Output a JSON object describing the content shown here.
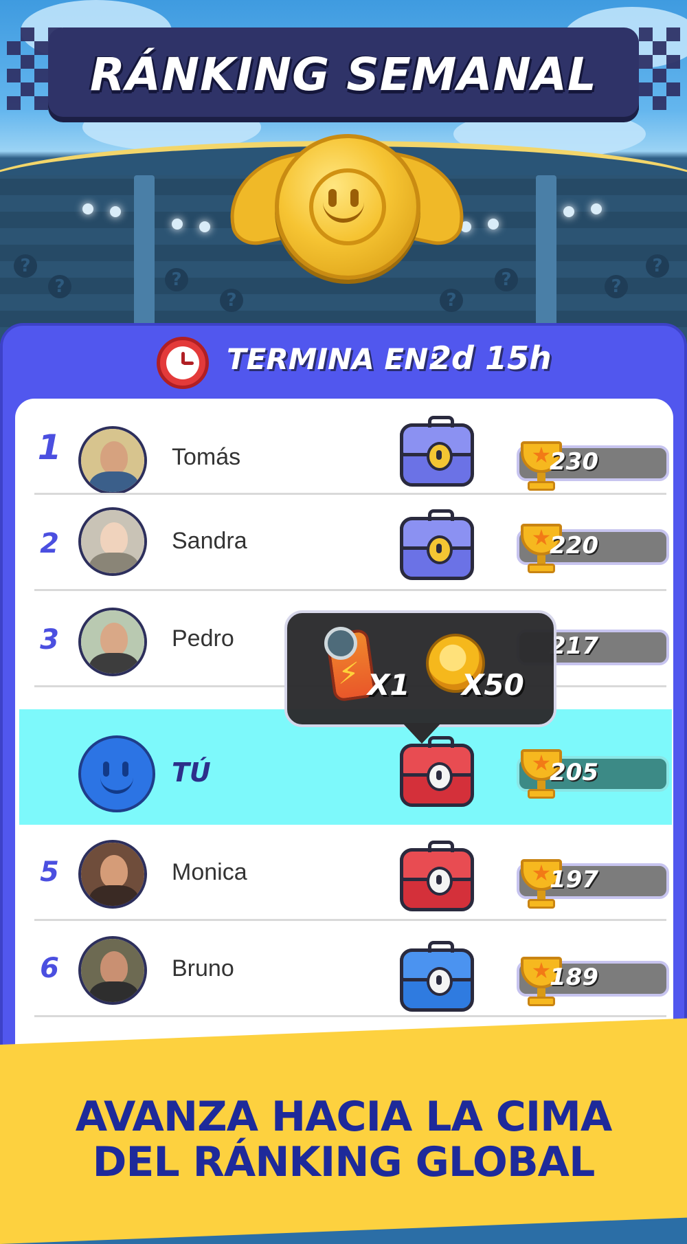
{
  "header": {
    "title": "RÁNKING SEMANAL"
  },
  "timer": {
    "label": "TERMINA EN:",
    "value": "2d 15h",
    "icon": "clock-icon"
  },
  "leaderboard": [
    {
      "rank": "1",
      "name": "Tomás",
      "score": "230",
      "chest": "purple-chest"
    },
    {
      "rank": "2",
      "name": "Sandra",
      "score": "220",
      "chest": "purple-chest"
    },
    {
      "rank": "3",
      "name": "Pedro",
      "score": "217",
      "chest": "purple-chest"
    },
    {
      "rank": "",
      "name": "TÚ",
      "score": "205",
      "chest": "red-chest",
      "is_me": true
    },
    {
      "rank": "5",
      "name": "Monica",
      "score": "197",
      "chest": "red-chest"
    },
    {
      "rank": "6",
      "name": "Bruno",
      "score": "189",
      "chest": "blue-chest"
    }
  ],
  "tooltip": {
    "rewards": [
      {
        "icon": "booster-icon",
        "qty": "X1"
      },
      {
        "icon": "coin-icon",
        "qty": "X50"
      }
    ]
  },
  "footer": {
    "line1": "AVANZA HACIA LA CIMA",
    "line2": "DEL RÁNKING GLOBAL"
  },
  "colors": {
    "panel": "#5157ee",
    "highlight_row": "#7df9fb",
    "footer": "#fdd13f",
    "footer_text": "#1e2a9a"
  }
}
